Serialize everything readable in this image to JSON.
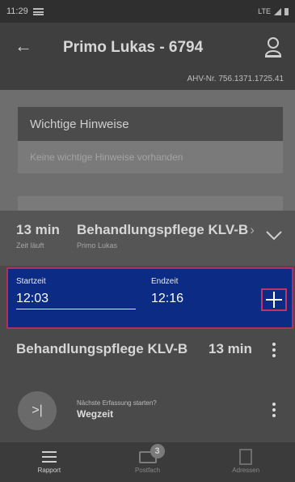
{
  "status_bar": {
    "time": "11:29",
    "network": "LTE"
  },
  "header": {
    "title": "Primo Lukas - 6794",
    "ahv": "AHV-Nr. 756.1371.1725.41"
  },
  "hints_card": {
    "title": "Wichtige Hinweise",
    "body": "Keine wichtige Hinweise vorhanden"
  },
  "timer": {
    "minutes": "13 min",
    "status": "Zeit läuft",
    "service": "Behandlungspflege KLV-B",
    "client": "Primo Lukas"
  },
  "time_entry": {
    "start_label": "Startzeit",
    "start_value": "12:03",
    "end_label": "Endzeit",
    "end_value": "12:16"
  },
  "service_row": {
    "title": "Behandlungspflege KLV-B",
    "duration": "13 min"
  },
  "next_entry": {
    "prompt": "Nächste Erfassung starten?",
    "value": "Wegzeit"
  },
  "bottom_nav": {
    "items": [
      {
        "label": "Rapport",
        "icon": "list-icon"
      },
      {
        "label": "Postfach",
        "icon": "mail-icon",
        "badge": "3"
      },
      {
        "label": "Adressen",
        "icon": "contact-icon"
      }
    ]
  },
  "colors": {
    "accent": "#0c2b84",
    "highlight_border": "#b0305c"
  }
}
